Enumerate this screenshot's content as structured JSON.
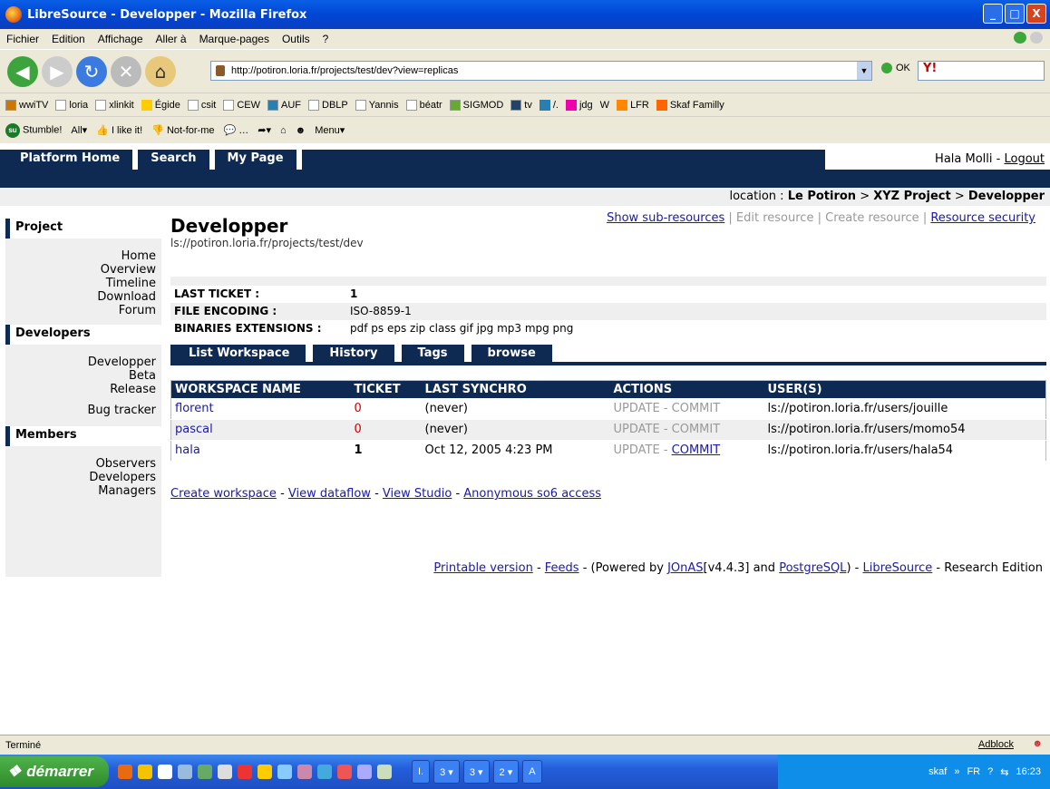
{
  "window": {
    "title": "LibreSource - Developper - Mozilla Firefox",
    "controls": [
      "_",
      "□",
      "X"
    ]
  },
  "menu": [
    "Fichier",
    "Edition",
    "Affichage",
    "Aller à",
    "Marque-pages",
    "Outils",
    "?"
  ],
  "navbar": {
    "url": "http://potiron.loria.fr/projects/test/dev?view=replicas",
    "ok_label": "OK",
    "search_logo": "Y!"
  },
  "bookmarks": [
    "wwiTV",
    "loria",
    "xlinkit",
    "Égide",
    "csit",
    "CEW",
    "AUF",
    "DBLP",
    "Yannis",
    "béatr",
    "SIGMOD",
    "tv",
    "/.",
    "jdg",
    "W",
    "LFR",
    "Skaf Familly"
  ],
  "stumble": {
    "stumble": "Stumble!",
    "all": "All▾",
    "like": "I like it!",
    "not": "Not-for-me",
    "more": "…",
    "menu": "Menu▾"
  },
  "site": {
    "topnav": [
      "Platform Home",
      "Search",
      "My Page"
    ],
    "user": "Hala Molli",
    "sep": " - ",
    "logout": "Logout",
    "location_label": "location : ",
    "location_path": [
      "Le Potiron",
      "XYZ Project",
      "Developper"
    ],
    "location_sep": " > "
  },
  "sidebar": {
    "project_head": "Project",
    "project_links": [
      "Home",
      "Overview",
      "Timeline",
      "Download",
      "Forum"
    ],
    "developers_head": "Developers",
    "developers_links": [
      "Developper",
      "Beta",
      "Release",
      "Bug tracker"
    ],
    "members_head": "Members",
    "members_links": [
      "Observers",
      "Developers",
      "Managers"
    ]
  },
  "resource": {
    "title": "Developper",
    "path": "ls://potiron.loria.fr/projects/test/dev",
    "actions": [
      "Show sub-resources",
      "Edit resource",
      "Create resource",
      "Resource security"
    ],
    "props": [
      {
        "k": "LAST TICKET :",
        "v": "1"
      },
      {
        "k": "FILE ENCODING :",
        "v": "ISO-8859-1"
      },
      {
        "k": "BINARIES EXTENSIONS :",
        "v": "pdf ps eps zip class gif jpg mp3 mpg png"
      }
    ],
    "tabs": [
      "List Workspace",
      "History",
      "Tags",
      "browse"
    ]
  },
  "workspaces": {
    "headers": [
      "WORKSPACE NAME",
      "TICKET",
      "LAST SYNCHRO",
      "ACTIONS",
      "USER(S)"
    ],
    "rows": [
      {
        "name": "florent",
        "ticket": "0",
        "synchro": "(never)",
        "update": "UPDATE",
        "commit": "COMMIT",
        "user": "ls://potiron.loria.fr/users/jouille"
      },
      {
        "name": "pascal",
        "ticket": "0",
        "synchro": "(never)",
        "update": "UPDATE",
        "commit": "COMMIT",
        "user": "ls://potiron.loria.fr/users/momo54"
      },
      {
        "name": "hala",
        "ticket": "1",
        "synchro": "Oct 12, 2005 4:23 PM",
        "update": "UPDATE",
        "commit": "COMMIT",
        "user": "ls://potiron.loria.fr/users/hala54"
      }
    ]
  },
  "bottom_links": [
    "Create workspace",
    "View dataflow",
    "View Studio",
    "Anonymous so6 access"
  ],
  "footer": {
    "printable": "Printable version",
    "feeds": "Feeds",
    "powered_pre": " - (Powered by ",
    "jonas": "JOnAS",
    "version": "[v4.4.3] and ",
    "postgres": "PostgreSQL",
    "mid": ") - ",
    "libresource": "LibreSource",
    "edition": " - Research Edition"
  },
  "status": {
    "text": "Terminé",
    "adblock": "Adblock"
  },
  "taskbar": {
    "start": "démarrer",
    "tasks": [
      "I.",
      "3 ▾",
      "3 ▾",
      "2 ▾",
      "A"
    ],
    "tray_text": "skaf",
    "lang": "FR",
    "clock": "16:23"
  }
}
